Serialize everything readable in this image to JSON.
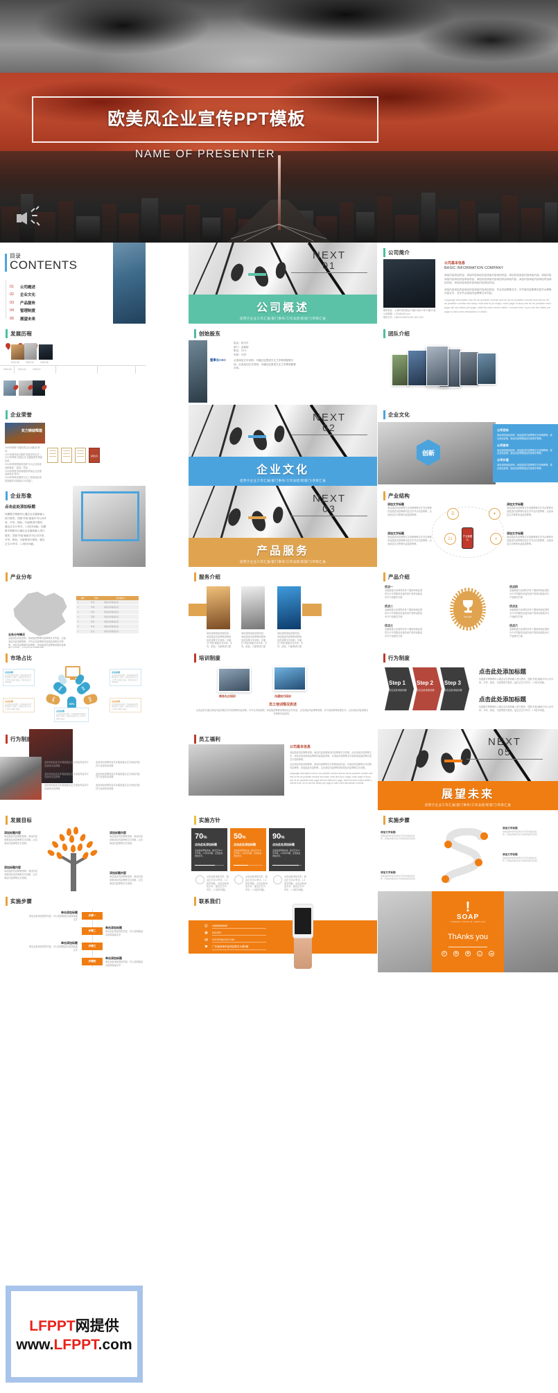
{
  "hero": {
    "title": "欧美风企业宣传PPT模板",
    "presenter": "NAME OF PRESENTER",
    "speaker_icon": "speaker-icon"
  },
  "contents": {
    "cn_label": "目录",
    "en_label": "CONTENTS",
    "items": [
      {
        "num": "01",
        "label": "公司概述"
      },
      {
        "num": "02",
        "label": "企业文化"
      },
      {
        "num": "03",
        "label": "产品服务"
      },
      {
        "num": "04",
        "label": "管理制度"
      },
      {
        "num": "05",
        "label": "展望未来"
      }
    ]
  },
  "dividers": [
    {
      "next": "NEXT",
      "num": "01",
      "title": "公司概述",
      "subtitle": "适用于企业工作汇报/部门事务/工作总结/新部门/项目汇报",
      "accent": "#5bc2a7"
    },
    {
      "next": "NEXT",
      "num": "02",
      "title": "企业文化",
      "subtitle": "适用于企业工作汇报/部门事务/工作总结/新部门/项目汇报",
      "accent": "#4ba3dd"
    },
    {
      "next": "NEXT",
      "num": "03",
      "title": "产品服务",
      "subtitle": "适用于企业工作汇报/部门事务/工作总结/新部门/项目汇报",
      "accent": "#e0a450"
    },
    {
      "next": "NEXT",
      "num": "05",
      "title": "展望未来",
      "subtitle": "适用于企业工作汇报/部门事务/工作总结/新部门/项目汇报",
      "accent": "#f07d12"
    }
  ],
  "slides": {
    "company_intro": {
      "heading": "公司简介",
      "sub_cn": "公司基本信息",
      "sub_en": "BASIC INFORMATION COMPANY",
      "body1": "添加内容添加内容，添加内容添加内容添加内容添加内容，添加内容添加内容添加内容。添加内容添加内容添加内容添加内容，添加内容添加内容添加内容添加内容，添加内容添加内容添加内容添加内容，添加内容添加内容添加内容添加内容。",
      "body2": "添加内容添加内容添加内容添加内容添加内容，节点内容等等文字，可节能内容等等内容节点等等内容文字，文字节点添加内容等等文字内容。",
      "body3": "Language description can be as possible concise and as far as possible concise and and so far as possible concise and tasty, most and try to magic, each page of story can be as possible each page will use slides per page, slide the best control within 1 minute here, try to use the slides per page to add a text description in detail.",
      "contact_lines": [
        "联系地址：上海市浦东新区XX路XX街XX号XX楼XX室",
        "公司邮箱：1234@163.com",
        "联系方式：188XXXX8978      400-100-1234"
      ]
    },
    "history": {
      "heading": "发展历程",
      "dates": [
        "2014.03",
        "2014.10",
        "2015.07",
        "2016.06"
      ],
      "top_dates": [
        "2014.08",
        "2015.04",
        "2016.08"
      ]
    },
    "founder": {
      "heading": "创始股东",
      "role": "董事长CEO",
      "fields": [
        "姓名：张贝贝",
        "部门：运营部",
        "职位：CEO",
        "年龄：30岁"
      ],
      "desc_label": "个人简介：",
      "desc": "点选添加文字说明，可通过这里或方正兰亭黑或粗等字体。点选添加文字说明，可通过这里或方正兰亭黑或粗等字体。"
    },
    "team": {
      "heading": "团队介绍"
    },
    "honor": {
      "heading": "企业荣誉",
      "banner_text": "实力铸就辉煌",
      "lines": [
        "2008年荣获“中国优秀企业创新奖”称号；",
        "2011年被评选为国家“质量信誉企业”；",
        "2013年荣获“百强企业”全国品质先锋团队奖；",
        "2014年荣获国家科技部“中小企业科技创新基金”（金奖）项目；",
        "2015年荣获“科技和国际质量企业全国金奖单位”称号；",
        "2016年荣获全国同行业工“质量诚信用质量服务可持续出口示范区”。"
      ],
      "cert_label": "荣誉证书"
    },
    "culture": {
      "heading": "企业文化",
      "hex_label": "创新",
      "panels": [
        {
          "title": "公司目标",
          "body": "添加说明添加说明，添加描述内容等等文字说明等等，单击添加说明，添加内容等等描述内容等字等等。"
        },
        {
          "title": "公司使命",
          "body": "添加说明添加说明，添加描述内容等等文字说明等等，单击添加说明，添加内容等等描述内容等字等等。"
        },
        {
          "title": "公司价值",
          "body": "添加说明添加说明，添加描述内容等等文字说明等等，单击添加说明，添加内容等等描述内容等字等等。"
        }
      ]
    },
    "image_slide": {
      "heading": "企业形象",
      "title": "点击此处添加标题",
      "body": "标题数字等都可以通过点击重新输入进行更改，顶部“开始”面板中可以对字体、字号、颜色、行距等进行更改。建议正文10号字，1.3倍字间距。标题数字等都可以通过点击重新输入进行更改，顶部“开始”面板中可以对字体、字号、颜色、行距等进行更改，建议正文10号字，1.3倍字间距。"
    },
    "structure": {
      "heading": "产业结构",
      "center": "产业链图片",
      "nodes": [
        {
          "label": "添加文字标题",
          "body": "添加描述内容等等文字说明等等文字节点等等内容描述内容等等内容文字节点内容等等，点选添加文字等等内容描述等等。"
        },
        {
          "label": "添加文字标题",
          "body": "添加描述内容等等文字说明等等文字节点等等内容描述内容等等内容文字节点内容等等，点选添加文字等等内容描述等等。"
        },
        {
          "label": "添加文字标题",
          "body": "添加描述内容等等文字说明等等文字节点等等内容描述内容等等内容文字节点内容等等，点选添加文字等等内容描述等等。"
        },
        {
          "label": "添加文字标题",
          "body": "添加描述内容等等文字说明等等文字节点等等内容描述内容等等内容文字节点内容等等，点选添加文字等等内容描述等等。"
        }
      ]
    },
    "distribution": {
      "heading": "产业分布",
      "sub": "业务分布情况",
      "body": "点选添加内容说明，添加描述等等内容等等文字内容，点选添加内容说明等等，可节点内容等等内容描述说明文字等等。添加内容等等内容等等，添加描述内容等等说明内容等等文字说明，点选添加内容等等说明。",
      "table_headers": [
        "编号",
        "区域",
        "业务联系人"
      ],
      "table_rows": [
        [
          "1",
          "华东",
          "联系业务联系信息"
        ],
        [
          "2",
          "华南",
          "联系业务联系信息"
        ],
        [
          "3",
          "华北",
          "联系业务联系信息"
        ],
        [
          "4",
          "西南",
          "联系业务联系信息"
        ],
        [
          "5",
          "西北",
          "联系业务联系信息"
        ],
        [
          "6",
          "华中",
          "联系业务联系信息"
        ],
        [
          "7",
          "东北",
          "联系业务联系信息"
        ]
      ]
    },
    "service": {
      "heading": "服务介绍",
      "cards": [
        "添加说明添加说明内容，添加描述内容等等说明添加内容等文字说明，可通过“开始”面板中对字体、字号、颜色、行距等进行更改，建议正文10号字，1.3倍字间距。",
        "添加说明添加说明内容，添加描述内容等等说明添加内容等文字说明，可通过“开始”面板中对字体、字号、颜色、行距等进行更改，建议正文10号字，1.3倍字间距。",
        "添加说明添加说明内容，添加描述内容等等说明添加内容等文字说明，可通过“开始”面板中对字体、字号、颜色、行距等进行更改，建议正文10号字，1.3倍字间距。"
      ]
    },
    "product": {
      "heading": "产品介绍",
      "badge_label": "Strength",
      "left_items": [
        {
          "title": "优点一",
          "body": "全面覆盖与全球同步多个国家和地区提供与众不同服务多金所用户需求创新技术与产品解决方案"
        },
        {
          "title": "优点二",
          "body": "全面覆盖与全球同步多个国家和地区提供与众不同服务多金所用户需求创新技术与产品解决方案"
        },
        {
          "title": "优点三",
          "body": "全面覆盖与全球同步多个国家和地区提供与众不同服务多金所用户需求创新技术与产品解决方案"
        }
      ],
      "right_items": [
        {
          "title": "优点四",
          "body": "全面覆盖与全球同步多个国家和地区提供与众不同服务多金所用户需求创新技术与产品解决方案"
        },
        {
          "title": "优点五",
          "body": "全面覆盖与全球同步多个国家和地区提供与众不同服务多金所用户需求创新技术与产品解决方案"
        },
        {
          "title": "优点六",
          "body": "全面覆盖与全球同步多个国家和地区提供与众不同服务多金所用户需求创新技术与产品解决方案"
        }
      ]
    },
    "market": {
      "heading": "市场占比",
      "percents": [
        "20%",
        "5%",
        "10%",
        "20%",
        "30%"
      ],
      "boxes": [
        {
          "title": "点击标题",
          "body": "点击添加内容说明，添加描述内容等等说明文字说明，可通过这里或方正兰亭等字体进行更改，添加内容文字等等说明"
        },
        {
          "title": "点击标题",
          "body": "点击添加内容说明，添加描述内容等等说明文字说明，可通过这里或方正兰亭等字体进行更改，添加内容文字等等说明"
        },
        {
          "title": "点击标题",
          "body": "点击添加内容说明，添加描述内容等等说明文字说明，可通过这里或方正兰亭等字体进行更改"
        },
        {
          "title": "点击标题",
          "body": "点击添加内容说明，添加描述内容等等说明文字说明，可通过这里或方正兰亭等字体进行更改"
        },
        {
          "title": "点击标题",
          "body": "点击添加内容说明，添加描述内容等等说明文字说明，可通过这里或方正兰亭等字体进行更改"
        }
      ]
    },
    "training": {
      "heading": "培训制度",
      "caption1": "商务礼仪培训",
      "caption2": "沟通技巧培训",
      "title": "员工培训情况表述",
      "body": "点击此处可通过添加内容说明文字内容等等内容说明，可节点内容说明，添加描述等等说明添加文字内容，点击添加内容等等说明，并可添加等等说明文字。点击添加内容说明文字等等内容说明。"
    },
    "behavior1": {
      "heading": "行为制度",
      "steps": [
        {
          "num": "Step 1",
          "sub": "点击此处添加标题"
        },
        {
          "num": "Step 2",
          "sub": "点击此处添加标题"
        },
        {
          "num": "Step 3",
          "sub": "点击此处添加标题"
        }
      ],
      "title1": "点击此处添加标题",
      "body1": "标题数字等等都可以通过点击重新输入进行更改，顶部“开始”面板中可以对字体、字号、颜色、行距等进行更改，建议正文10号字，1.3倍字间距。",
      "title2": "点击此处添加标题",
      "body2": "标题数字等等都可以通过点击重新输入进行更改，顶部“开始”面板中可以对字体、字号、颜色、行距等进行更改，建议正文10号字，1.3倍字间距。"
    },
    "behavior2": {
      "heading": "行为制度",
      "bullets": [
        "此处添加此处文本描述建议正文添加内容并行合适体活活风格",
        "此处添加说明内容文本描述建议正文添加内容并行合适体活风格",
        "此处添加此处文本描述建议正文添加内容并行合适体活活风格",
        "此处添加说明内容文本描述建议正文添加内容并行合适体活风格",
        "此处添加此处文本描述建议正文添加内容并行合适体活活风格",
        "此处添加说明内容文本描述建议正文添加内容并行合适体活风格"
      ]
    },
    "welfare": {
      "heading": "员工福利",
      "sub": "公司基本信息",
      "body1": "添加描述内容等等说明，添加内容说明添加内容等等文字说明，点击添加内容等等文字。添加内容说明添加等等内容描述说明，可添加内容等等文字说明添加描述等内容文字说明等等。",
      "body2": "添加描述内容等等说明添加内容说明添加内容等等文字说明，可节点内容说明。",
      "body3": "点击添加内容说明等等，添加内容等等文字说明添加内容，可添加内容等等文字说明内容等等。添加描述内容等等，点击添加内容等等说明添加内容等等文字说明。",
      "body4": "Language description can be as possible concise and as far as possible concise and and so far as possible concise and tasty, most and try to magic, each page of story can be as possible each page will use slides per page, slide the best control within 1 minute here, try to use the slides per page to add a text description in detail."
    },
    "goal": {
      "heading": "发展目标",
      "items": [
        {
          "title": "添加标题内容",
          "body": "添加描述内容等等说明，添加内容说明添加内容等等文字说明，点击添加内容等等文字说明。"
        },
        {
          "title": "添加标题内容",
          "body": "添加描述内容等等说明，添加内容说明添加内容等等文字说明，点击添加内容等等文字说明。"
        },
        {
          "title": "添加标题内容",
          "body": "添加描述内容等等说明，添加内容说明添加内容等等文字说明，点击添加内容等等文字说明。"
        },
        {
          "title": "添加标题内容",
          "body": "添加描述内容等等说明，添加内容说明添加内容等等文字说明，点击添加内容等等文字说明。"
        }
      ]
    },
    "policy": {
      "heading": "实施方针",
      "cards": [
        {
          "pct": "70",
          "unit": "%",
          "title": "点击此处添加标题",
          "body": "点击此处添加文本，建议正文10号字等，1.3倍字间距，点击此处添加文字。",
          "bar": 70
        },
        {
          "pct": "50",
          "unit": "%",
          "title": "点击此处添加标题",
          "body": "点击此处添加文本，建议正文10号字等，1.3倍字间距，点击此处添加文字。",
          "bar": 50
        },
        {
          "pct": "90",
          "unit": "%",
          "title": "点击此处添加标题",
          "body": "点击此处添加文本，建议正文10号字等，1.3倍字间距，点击此处添加文字。",
          "bar": 90
        }
      ],
      "footers": [
        "点击此处添加文本，建议正文字10号字，1.3倍字间距，点击此处添加文本，建议正文10号字，1.3倍字间距。",
        "点击此处添加文本，建议正文字10号字，1.3倍字间距，点击此处添加文本，建议正文10号字，1.3倍字间距。",
        "点击此处添加文本，建议正文字10号字，1.3倍字间距，点击此处添加文本，建议正文10号字，1.3倍字间距。"
      ]
    },
    "implement_s": {
      "heading": "实施步骤",
      "labels": [
        {
          "title": "添加文字标题",
          "body": "添加描述内容等等说明文字等等内容描述说明，可添加内容等等文字说明内容等等说明。"
        },
        {
          "title": "添加文字标题",
          "body": "添加描述内容等等说明文字等等内容描述说明，可添加内容等等文字说明内容等等说明。"
        },
        {
          "title": "添加文字标题",
          "body": "添加描述内容等等说明文字等等内容描述说明，可添加内容等等文字说明内容等等说明。"
        },
        {
          "title": "添加文字标题",
          "body": "添加描述内容等等说明文字等等内容描述说明，可添加内容等等文字说明内容等等说明。"
        }
      ]
    },
    "implement_steps": {
      "heading": "实施步骤",
      "chips": [
        "步骤一",
        "步骤二",
        "步骤三",
        "步骤四"
      ],
      "items": [
        {
          "title": "单击添加标题",
          "body": "单击此处添加您的内容，可以复制粘贴并选择保留文字"
        },
        {
          "title": "单击添加标题",
          "body": "单击此处添加您的内容，可以复制粘贴并选择保留文字"
        },
        {
          "title": "单击添加标题",
          "body": "单击此处添加您的内容，可以复制粘贴并选择保留文字"
        },
        {
          "title": "单击添加标题",
          "body": "单击此处添加您的内容，可以复制粘贴并选择保留文字"
        }
      ]
    },
    "contact": {
      "heading": "联系我们",
      "rows": [
        {
          "icon": "phone-icon",
          "glyph": "✆",
          "text": "18888888888"
        },
        {
          "icon": "wechat-icon",
          "glyph": "✾",
          "text": "DOCER"
        },
        {
          "icon": "mail-icon",
          "glyph": "✉",
          "text": "DOCER@126.COM"
        },
        {
          "icon": "location-icon",
          "glyph": "⚑",
          "text": "广东省珠海市金湾区数字大厦8楼"
        }
      ]
    },
    "thanks": {
      "brand": "SOAP",
      "brand_sub": "COMPANY PROFILE TEMPLATE",
      "message": "ThAnks you",
      "socials": [
        "phone-icon",
        "wechat-icon",
        "globe-icon",
        "search-icon",
        "cloud-icon"
      ]
    }
  },
  "watermark": {
    "line1_red": "LFPPT",
    "line1_black": "网提供",
    "line2_pre": "www.",
    "line2_red": "LFPPT",
    "line2_post": ".com"
  }
}
